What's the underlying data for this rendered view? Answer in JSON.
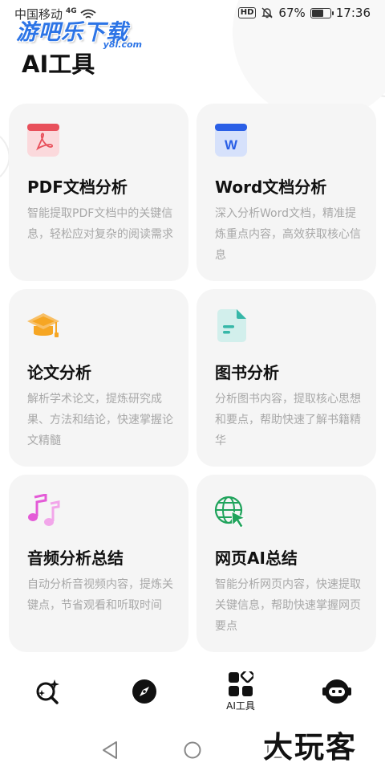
{
  "status_bar": {
    "carrier": "中国移动",
    "network": "4G",
    "hd": "HD",
    "battery_percent": "67%",
    "battery_level": 0.67,
    "time": "17:36"
  },
  "watermark": {
    "title": "游吧乐下载",
    "subtitle": "y8l.com",
    "corner": "大玩客"
  },
  "page": {
    "title": "AI工具"
  },
  "cards": [
    {
      "title": "PDF文档分析",
      "desc": "智能提取PDF文档中的关键信息，轻松应对复杂的阅读需求",
      "icon": "pdf-icon"
    },
    {
      "title": "Word文档分析",
      "desc": "深入分析Word文档，精准提炼重点内容，高效获取核心信息",
      "icon": "word-icon",
      "icon_letter": "W"
    },
    {
      "title": "论文分析",
      "desc": "解析学术论文，提炼研究成果、方法和结论，快速掌握论文精髓",
      "icon": "graduation-cap-icon"
    },
    {
      "title": "图书分析",
      "desc": "分析图书内容，提取核心思想和要点，帮助快速了解书籍精华",
      "icon": "book-icon"
    },
    {
      "title": "音频分析总结",
      "desc": "自动分析音视频内容，提炼关键点，节省观看和听取时间",
      "icon": "music-notes-icon"
    },
    {
      "title": "网页AI总结",
      "desc": "智能分析网页内容，快速提取关键信息，帮助快速掌握网页要点",
      "icon": "globe-cursor-icon"
    }
  ],
  "bottom_nav": {
    "items": [
      {
        "icon": "search-sparkle-icon",
        "label": ""
      },
      {
        "icon": "compass-icon",
        "label": ""
      },
      {
        "icon": "apps-grid-icon",
        "label": "AI工具"
      },
      {
        "icon": "robot-icon",
        "label": ""
      }
    ]
  },
  "colors": {
    "card_bg": "#f5f5f5",
    "desc_text": "#a8a8a8",
    "pdf_red": "#e8505b",
    "word_blue": "#2a5fe6",
    "cap_orange": "#f6a623",
    "book_teal": "#36b7a8",
    "music_pink": "#e45bd7",
    "globe_green": "#1fa35b"
  }
}
